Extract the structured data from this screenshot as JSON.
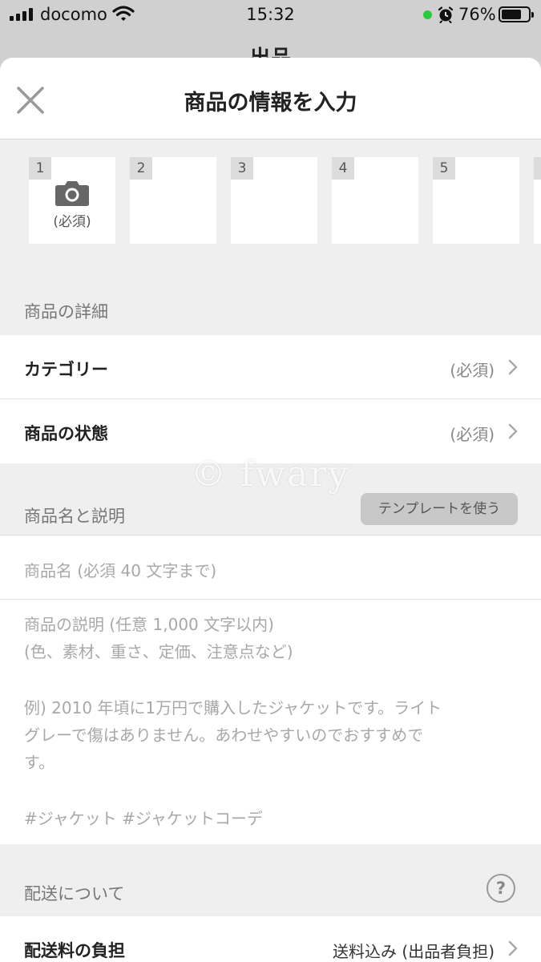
{
  "status_bar": {
    "carrier": "docomo",
    "time": "15:32",
    "battery": "76%",
    "battery_level": 0.76
  },
  "behind_title": "出品",
  "header": {
    "title": "商品の情報を入力",
    "close_icon": "close-icon"
  },
  "photos": {
    "slots": [
      "1",
      "2",
      "3",
      "4",
      "5"
    ],
    "required_label": "(必須)",
    "camera_icon": "camera-icon"
  },
  "details": {
    "section_label": "商品の詳細",
    "category_label": "カテゴリー",
    "category_value": "(必須)",
    "condition_label": "商品の状態",
    "condition_value": "(必須)"
  },
  "name_desc": {
    "section_label": "商品名と説明",
    "template_button": "テンプレートを使う",
    "name_placeholder": "商品名 (必須 40 文字まで)",
    "desc_lines": [
      "商品の説明 (任意 1,000 文字以内)",
      "(色、素材、重さ、定価、注意点など)",
      "例) 2010 年頃に1万円で購入したジャケットです。ライト",
      "グレーで傷はありません。あわせやすいのでおすすめで",
      "す。",
      "#ジャケット #ジャケットコーデ"
    ]
  },
  "shipping": {
    "section_label": "配送について",
    "help_icon": "?",
    "fee_label": "配送料の負担",
    "fee_value": "送料込み (出品者負担)"
  },
  "watermark": "© fwary",
  "colors": {
    "sheet_bg": "#efefef",
    "signal_dot": "#2bc840"
  }
}
